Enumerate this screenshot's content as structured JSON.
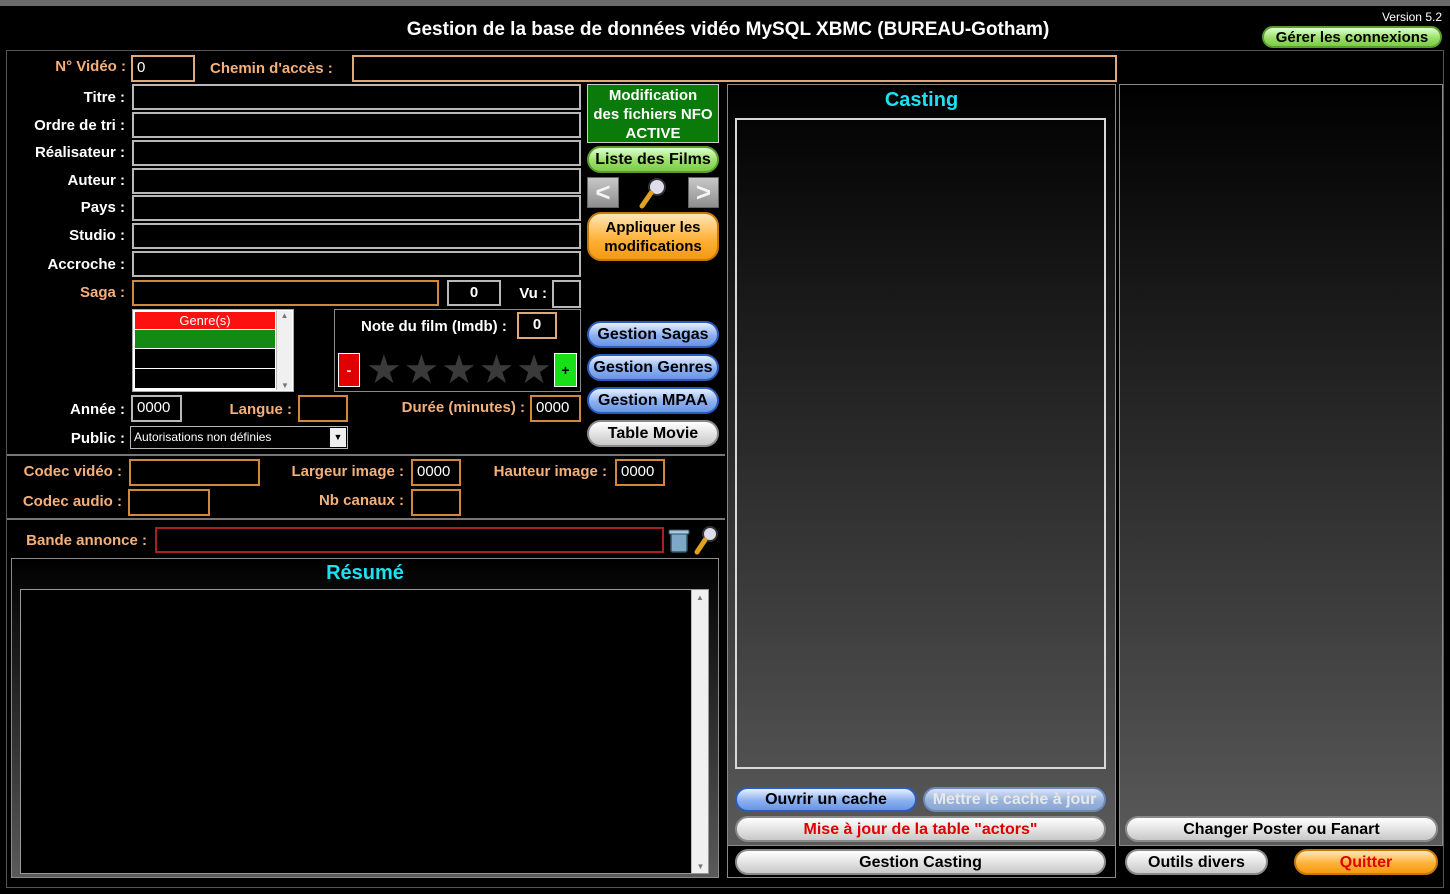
{
  "window": {
    "title": "Gestion de la base de données vidéo MySQL XBMC (BUREAU-Gotham)",
    "version": "Version 5.2",
    "manage_connections": "Gérer les connexions"
  },
  "fields": {
    "video_no_label": "N° Vidéo :",
    "video_no_value": "0",
    "path_label": "Chemin d'accès :",
    "path_value": "",
    "title_label": "Titre :",
    "sort_label": "Ordre de tri :",
    "director_label": "Réalisateur :",
    "author_label": "Auteur :",
    "country_label": "Pays :",
    "studio_label": "Studio :",
    "tagline_label": "Accroche :",
    "saga_label": "Saga :",
    "saga_count": "0",
    "seen_label": "Vu :",
    "genre_header": "Genre(s)",
    "rating_label": "Note du film (Imdb) :",
    "rating_value": "0",
    "rating_minus": "-",
    "rating_plus": "+",
    "year_label": "Année :",
    "year_value": "0000",
    "language_label": "Langue :",
    "duration_label": "Durée (minutes) :",
    "duration_value": "0000",
    "public_label": "Public :",
    "public_value": "Autorisations non définies",
    "codec_video_label": "Codec vidéo :",
    "width_label": "Largeur image :",
    "width_value": "0000",
    "height_label": "Hauteur image :",
    "height_value": "0000",
    "codec_audio_label": "Codec audio :",
    "channels_label": "Nb canaux :",
    "trailer_label": "Bande annonce :"
  },
  "nfo_status": {
    "line1": "Modification",
    "line2": "des fichiers NFO",
    "line3": "ACTIVE"
  },
  "buttons": {
    "film_list": "Liste des Films",
    "prev": "<",
    "next": ">",
    "apply_line1": "Appliquer les",
    "apply_line2": "modifications",
    "sagas": "Gestion Sagas",
    "genres": "Gestion Genres",
    "mpaa": "Gestion MPAA",
    "table_movie": "Table Movie",
    "open_cache": "Ouvrir un cache",
    "update_cache": "Mettre le cache à jour",
    "update_actors": "Mise à jour de la table \"actors\"",
    "casting_mgmt": "Gestion Casting",
    "change_poster": "Changer Poster ou Fanart",
    "tools": "Outils divers",
    "quit": "Quitter"
  },
  "sections": {
    "casting": "Casting",
    "summary": "Résumé"
  },
  "colors": {
    "accent_cyan": "#1fe0f0",
    "label_orange": "#f5b07a",
    "nfo_green": "#0a7a0a",
    "genre_red": "#ff1010",
    "genre_green": "#138a13",
    "quit_text": "#e00000",
    "actors_text": "#e00000"
  },
  "icons": {
    "search": "magnifier-icon",
    "trash": "trash-icon",
    "star": "star-icon"
  }
}
